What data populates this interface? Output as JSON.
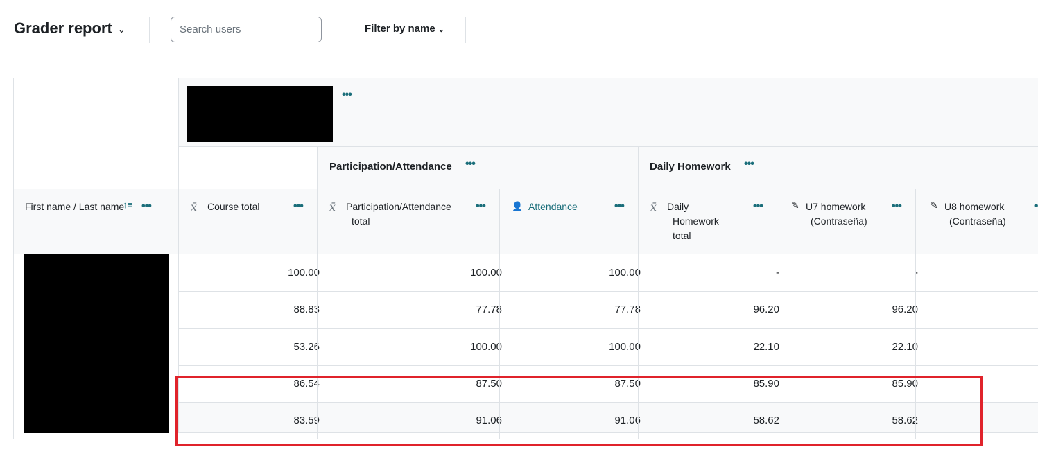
{
  "header": {
    "title": "Grader report",
    "search_placeholder": "Search users",
    "filter_label": "Filter by name"
  },
  "categories": [
    {
      "name": "Participation/Attendance"
    },
    {
      "name": "Daily Homework"
    }
  ],
  "columns": {
    "name": {
      "label": "First name / Last name"
    },
    "course_total": {
      "label": "Course total"
    },
    "part_total": {
      "line1": "Participation/Attendance",
      "line2": "total"
    },
    "attendance": {
      "label": "Attendance"
    },
    "hw_total": {
      "line1": "Daily",
      "line2": "Homework",
      "line3": "total"
    },
    "u7": {
      "line1": "U7 homework",
      "line2": "(Contraseña)"
    },
    "u8": {
      "line1": "U8 homework",
      "line2": "(Contraseña)"
    }
  },
  "rows": [
    {
      "course_total": "100.00",
      "part_total": "100.00",
      "attendance": "100.00",
      "hw_total": "-",
      "u7": "-"
    },
    {
      "course_total": "88.83",
      "part_total": "77.78",
      "attendance": "77.78",
      "hw_total": "96.20",
      "u7": "96.20"
    },
    {
      "course_total": "53.26",
      "part_total": "100.00",
      "attendance": "100.00",
      "hw_total": "22.10",
      "u7": "22.10"
    },
    {
      "course_total": "86.54",
      "part_total": "87.50",
      "attendance": "87.50",
      "hw_total": "85.90",
      "u7": "85.90"
    },
    {
      "course_total": "83.59",
      "part_total": "91.06",
      "attendance": "91.06",
      "hw_total": "58.62",
      "u7": "58.62"
    }
  ],
  "icons": {
    "menu": "more-actions-icon",
    "aggregate": "x-bar-icon",
    "attendance": "attendance-icon",
    "assignment": "edit-icon",
    "sort": "sort-icon"
  },
  "colors": {
    "accent": "#1a6e7a",
    "highlight": "#e0232b",
    "border": "#dee2e6"
  }
}
